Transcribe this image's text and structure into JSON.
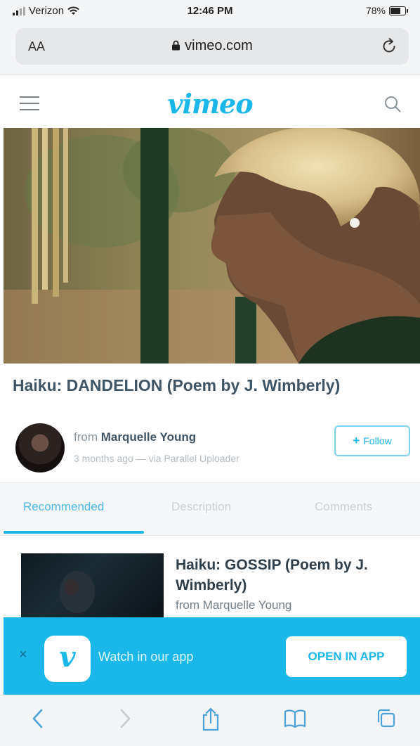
{
  "status_bar": {
    "carrier": "Verizon",
    "time": "12:46 PM",
    "battery": "78%",
    "battery_level": 0.78
  },
  "browser": {
    "aa_label": "AA",
    "url": "vimeo.com"
  },
  "header": {
    "logo": "vimeo"
  },
  "video": {
    "title": "Haiku: DANDELION (Poem by J. Wimberly)",
    "from_label": "from",
    "author": "Marquelle Young",
    "meta": "3 months ago — via Parallel Uploader",
    "follow_label": "Follow"
  },
  "tabs": [
    {
      "label": "Recommended",
      "active": true
    },
    {
      "label": "Description",
      "active": false
    },
    {
      "label": "Comments",
      "active": false
    }
  ],
  "recommended": [
    {
      "title": "Haiku: GOSSIP (Poem by J. Wimberly)",
      "from": "from Marquelle Young"
    }
  ],
  "app_banner": {
    "close_glyph": "×",
    "app_icon_letter": "v",
    "message": "Watch in our app",
    "button_label": "OPEN IN APP"
  },
  "toolbar": {
    "icons": [
      "back-icon",
      "forward-icon",
      "share-icon",
      "bookmarks-icon",
      "tabs-icon"
    ]
  },
  "colors": {
    "brand": "#1ab7ea",
    "title_text": "#3f5566"
  }
}
